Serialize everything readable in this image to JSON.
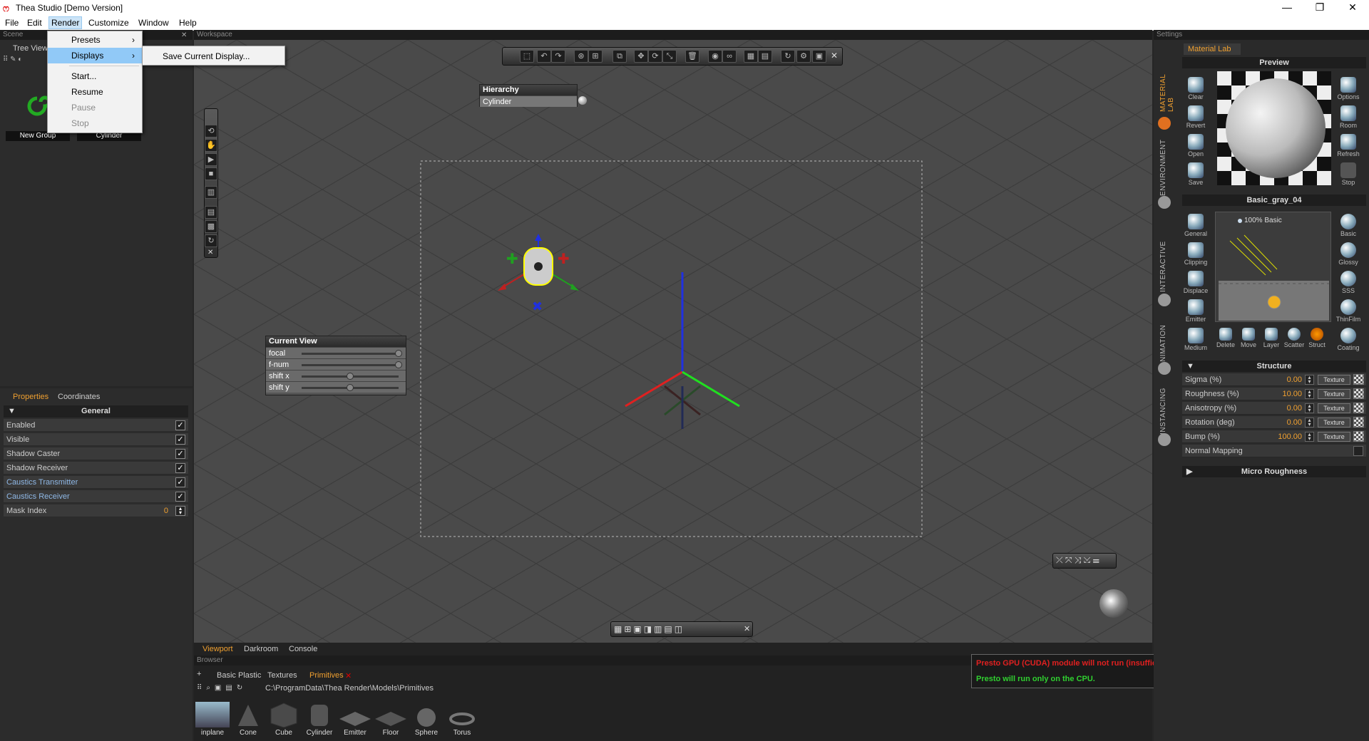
{
  "window": {
    "title": "Thea Studio [Demo Version]",
    "minimize": "—",
    "maximize": "❐",
    "close": "✕"
  },
  "menu": [
    "File",
    "Edit",
    "Render",
    "Customize",
    "Window",
    "Help"
  ],
  "render_menu": {
    "items": [
      "Presets",
      "Displays",
      "Start...",
      "Resume",
      "Pause",
      "Stop"
    ],
    "disabled": [
      "Pause",
      "Stop"
    ],
    "submenu_item": "Save Current Display..."
  },
  "scene": {
    "header": "Scene",
    "tree_tab": "Tree View",
    "nodes": [
      "New Group",
      "Cylinder"
    ]
  },
  "properties": {
    "tabs": [
      "Properties",
      "Coordinates"
    ],
    "section": "General",
    "rows": [
      {
        "label": "Enabled",
        "checked": true
      },
      {
        "label": "Visible",
        "checked": true
      },
      {
        "label": "Shadow Caster",
        "checked": true
      },
      {
        "label": "Shadow Receiver",
        "checked": true
      },
      {
        "label": "Caustics Transmitter",
        "checked": true
      },
      {
        "label": "Caustics Receiver",
        "checked": true
      }
    ],
    "mask_label": "Mask Index",
    "mask_value": "0"
  },
  "workspace": {
    "header": "Workspace"
  },
  "hierarchy": {
    "title": "Hierarchy",
    "item": "Cylinder"
  },
  "current_view": {
    "title": "Current View",
    "params": [
      {
        "label": "focal",
        "value": 1.0
      },
      {
        "label": "f-num",
        "value": 1.0
      },
      {
        "label": "shift x",
        "value": 0.5
      },
      {
        "label": "shift y",
        "value": 0.5
      }
    ]
  },
  "bottom_tabs": [
    "Viewport",
    "Darkroom",
    "Console"
  ],
  "browser": {
    "header": "Browser",
    "tabs": [
      "Basic Plastic",
      "Textures",
      "Primitives"
    ],
    "path": "C:\\ProgramData\\Thea Render\\Models\\Primitives",
    "items": [
      "inplane",
      "Cone",
      "Cube",
      "Cylinder",
      "Emitter",
      "Floor",
      "Sphere",
      "Torus"
    ]
  },
  "notifications": [
    {
      "text": "Presto GPU (CUDA) module will not run (insufficient driver). Update your graphics driver.",
      "color": "#e02020"
    },
    {
      "text": "Presto will run only on the CPU.",
      "color": "#30d030"
    }
  ],
  "settings": {
    "header": "Settings",
    "vtabs": [
      "MATERIAL LAB",
      "ENVIRONMENT",
      "INTERACTIVE",
      "ANIMATION",
      "INSTANCING"
    ],
    "material_tab": "Material Lab",
    "preview_title": "Preview",
    "preview_left_icons": [
      "Clear",
      "Revert",
      "Open",
      "Save"
    ],
    "preview_right_icons": [
      "Options",
      "Room",
      "Refresh",
      "Stop"
    ],
    "material_name": "Basic_gray_04",
    "layer_label": "100% Basic",
    "left_icons": [
      "General",
      "Clipping",
      "Displace",
      "Emitter",
      "Medium"
    ],
    "right_icons": [
      "Basic",
      "Glossy",
      "SSS",
      "ThinFilm",
      "Coating"
    ],
    "bottom_icons": [
      "Delete",
      "Move",
      "Layer",
      "Scatter",
      "Struct"
    ],
    "structure_title": "Structure",
    "structure_rows": [
      {
        "label": "Sigma (%)",
        "value": "0.00",
        "tex": "Texture"
      },
      {
        "label": "Roughness (%)",
        "value": "10.00",
        "tex": "Texture"
      },
      {
        "label": "Anisotropy (%)",
        "value": "0.00",
        "tex": "Texture"
      },
      {
        "label": "Rotation (deg)",
        "value": "0.00",
        "tex": "Texture"
      },
      {
        "label": "Bump (%)",
        "value": "100.00",
        "tex": "Texture"
      }
    ],
    "normal_mapping": "Normal Mapping",
    "micro_roughness": "Micro Roughness"
  },
  "colors": {
    "accent": "#f0a030",
    "axis_x": "#e02020",
    "axis_y": "#20e020",
    "axis_z": "#2030e0"
  }
}
